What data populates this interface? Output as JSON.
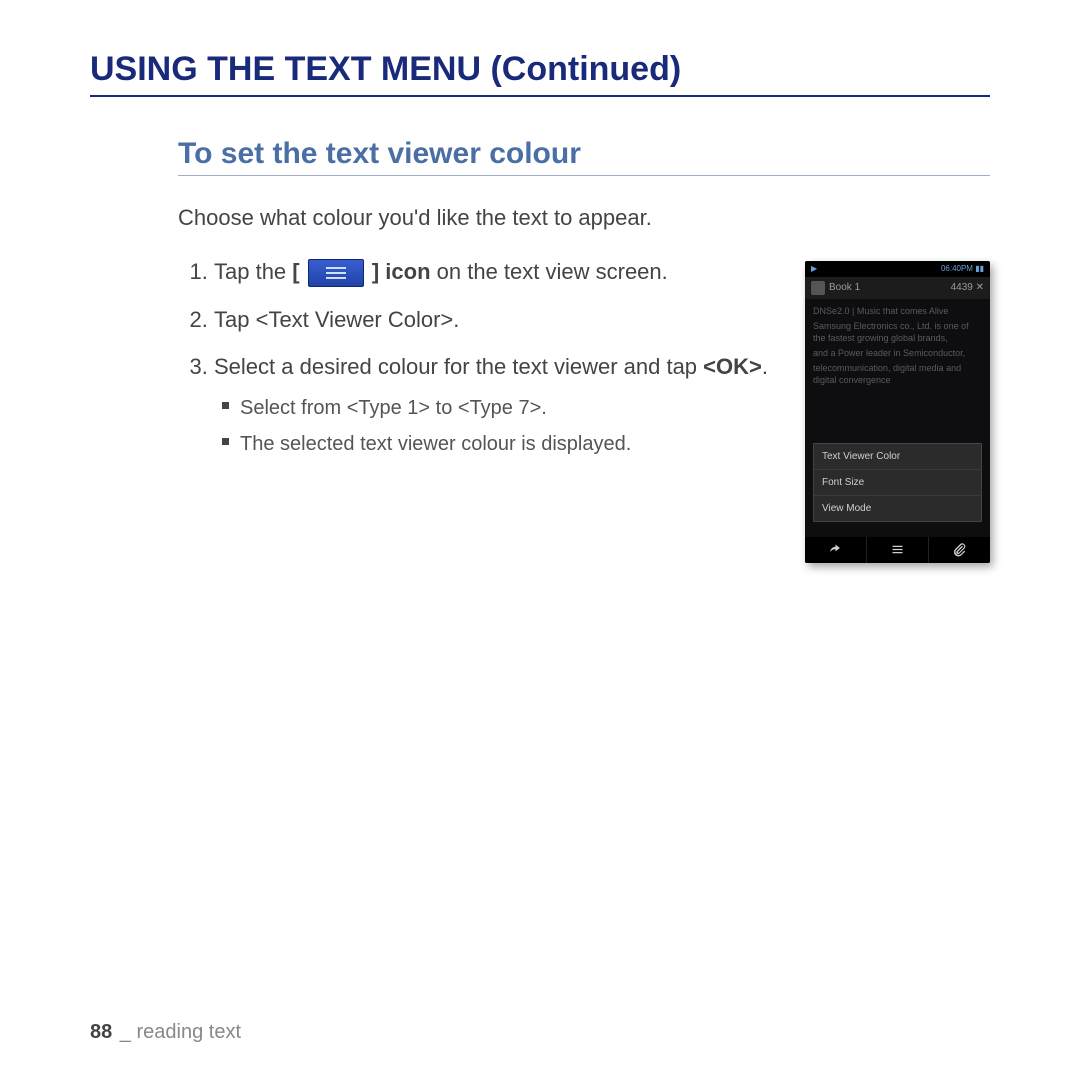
{
  "heading": "USING THE TEXT MENU (Continued)",
  "subheading": "To set the text viewer colour",
  "intro": "Choose what colour you'd like the text to appear.",
  "step1_pre": "Tap the ",
  "step1_bracket_open": "[",
  "step1_bracket_close": "]",
  "step1_icon_word": " icon",
  "step1_post": " on the text view screen.",
  "step2_pre": "Tap ",
  "step2_bold": "<Text Viewer Color>",
  "step2_post": ".",
  "step3_pre": "Select a desired colour for the text viewer and tap ",
  "step3_bold": "<OK>",
  "step3_post": ".",
  "sub1": "Select from <Type 1> to <Type 7>.",
  "sub2": "The selected text viewer colour is displayed.",
  "footer_page": "88",
  "footer_sep": " _ ",
  "footer_section": "reading text",
  "device": {
    "status_left": "▶",
    "status_right": "06:40PM ▮▮",
    "title": "Book 1",
    "title_right": "4439  ✕",
    "body": [
      "DNSe2.0 | Music that comes Alive",
      "Samsung Electronics co., Ltd. is one of the fastest growing global brands,",
      "and a Power leader in Semiconductor,",
      "telecommunication, digital media and digital convergence"
    ],
    "menu": [
      "Text Viewer Color",
      "Font Size",
      "View Mode"
    ]
  }
}
